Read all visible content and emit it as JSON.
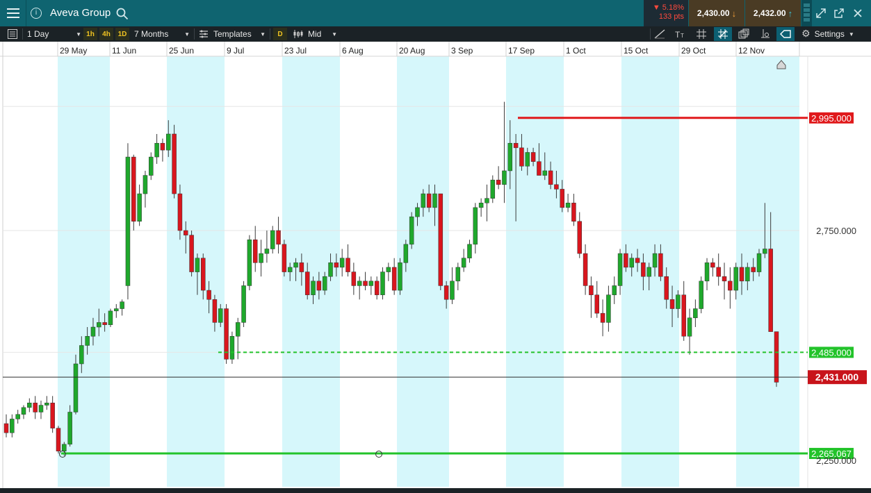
{
  "header": {
    "title": "Aveva Group",
    "change_pct": "▼ 5.18%",
    "change_pts": "133 pts",
    "sell_price": "2,430.00",
    "buy_price": "2,432.00"
  },
  "toolbar": {
    "interval": "1 Day",
    "quick_intervals": [
      "1h",
      "4h",
      "1D"
    ],
    "range": "7 Months",
    "templates_label": "Templates",
    "d_label": "D",
    "price_type": "Mid",
    "settings_label": "Settings"
  },
  "chart_data": {
    "type": "candlestick",
    "x_axis_ticks": [
      "29 May",
      "11 Jun",
      "25 Jun",
      "9 Jul",
      "23 Jul",
      "6 Aug",
      "20 Aug",
      "3 Sep",
      "17 Sep",
      "1 Oct",
      "15 Oct",
      "29 Oct",
      "12 Nov"
    ],
    "y_axis_ticks": [
      "2,250.000",
      "2,750.000"
    ],
    "y_range": [
      2210,
      3340
    ],
    "horizontal_lines": [
      {
        "label": "2,995.000",
        "value": 2995,
        "color": "#e0191b",
        "style": "solid"
      },
      {
        "label": "2,485.000",
        "value": 2485,
        "color": "#22c32a",
        "style": "dashed"
      },
      {
        "label": "2,265.067",
        "value": 2265.067,
        "color": "#22c32a",
        "style": "solid"
      }
    ],
    "current_price": {
      "label": "2,431.000",
      "value": 2431,
      "color": "#c8141b"
    },
    "colors": {
      "up": "#1fa82c",
      "down": "#d9161e",
      "band": "#d6f7fb",
      "grid": "#e6e6e6"
    },
    "candles": [
      [
        2330,
        2350,
        2300,
        2310
      ],
      [
        2310,
        2350,
        2300,
        2340
      ],
      [
        2340,
        2360,
        2330,
        2350
      ],
      [
        2350,
        2370,
        2340,
        2365
      ],
      [
        2365,
        2385,
        2355,
        2375
      ],
      [
        2375,
        2390,
        2340,
        2355
      ],
      [
        2355,
        2380,
        2340,
        2370
      ],
      [
        2370,
        2390,
        2360,
        2375
      ],
      [
        2375,
        2390,
        2310,
        2320
      ],
      [
        2320,
        2325,
        2265,
        2270
      ],
      [
        2270,
        2290,
        2260,
        2285
      ],
      [
        2285,
        2370,
        2280,
        2355
      ],
      [
        2355,
        2480,
        2350,
        2460
      ],
      [
        2460,
        2520,
        2440,
        2500
      ],
      [
        2500,
        2540,
        2480,
        2520
      ],
      [
        2520,
        2560,
        2500,
        2540
      ],
      [
        2540,
        2580,
        2520,
        2550
      ],
      [
        2550,
        2570,
        2530,
        2545
      ],
      [
        2545,
        2580,
        2540,
        2575
      ],
      [
        2575,
        2590,
        2560,
        2580
      ],
      [
        2580,
        2600,
        2565,
        2595
      ],
      [
        2630,
        2940,
        2600,
        2910
      ],
      [
        2910,
        2915,
        2750,
        2770
      ],
      [
        2770,
        2850,
        2760,
        2830
      ],
      [
        2830,
        2880,
        2800,
        2870
      ],
      [
        2870,
        2920,
        2860,
        2910
      ],
      [
        2910,
        2960,
        2895,
        2940
      ],
      [
        2940,
        2950,
        2900,
        2925
      ],
      [
        2925,
        2990,
        2910,
        2960
      ],
      [
        2960,
        2980,
        2820,
        2830
      ],
      [
        2830,
        2850,
        2730,
        2750
      ],
      [
        2750,
        2770,
        2700,
        2740
      ],
      [
        2740,
        2750,
        2650,
        2660
      ],
      [
        2660,
        2700,
        2610,
        2690
      ],
      [
        2690,
        2700,
        2600,
        2620
      ],
      [
        2620,
        2640,
        2570,
        2600
      ],
      [
        2600,
        2610,
        2530,
        2550
      ],
      [
        2550,
        2590,
        2540,
        2580
      ],
      [
        2580,
        2590,
        2460,
        2470
      ],
      [
        2470,
        2530,
        2460,
        2520
      ],
      [
        2520,
        2560,
        2470,
        2550
      ],
      [
        2550,
        2640,
        2540,
        2630
      ],
      [
        2630,
        2740,
        2620,
        2730
      ],
      [
        2730,
        2760,
        2660,
        2680
      ],
      [
        2680,
        2730,
        2650,
        2700
      ],
      [
        2700,
        2750,
        2680,
        2710
      ],
      [
        2710,
        2760,
        2700,
        2750
      ],
      [
        2750,
        2780,
        2700,
        2720
      ],
      [
        2720,
        2730,
        2650,
        2660
      ],
      [
        2660,
        2680,
        2640,
        2670
      ],
      [
        2670,
        2690,
        2640,
        2680
      ],
      [
        2680,
        2700,
        2630,
        2660
      ],
      [
        2660,
        2680,
        2600,
        2610
      ],
      [
        2610,
        2650,
        2590,
        2640
      ],
      [
        2640,
        2660,
        2600,
        2620
      ],
      [
        2620,
        2660,
        2610,
        2650
      ],
      [
        2650,
        2700,
        2640,
        2680
      ],
      [
        2680,
        2700,
        2650,
        2670
      ],
      [
        2670,
        2710,
        2650,
        2690
      ],
      [
        2690,
        2720,
        2650,
        2660
      ],
      [
        2660,
        2680,
        2610,
        2630
      ],
      [
        2630,
        2650,
        2600,
        2640
      ],
      [
        2640,
        2660,
        2620,
        2630
      ],
      [
        2630,
        2650,
        2610,
        2640
      ],
      [
        2640,
        2650,
        2600,
        2610
      ],
      [
        2610,
        2670,
        2600,
        2660
      ],
      [
        2660,
        2680,
        2640,
        2670
      ],
      [
        2670,
        2690,
        2610,
        2620
      ],
      [
        2620,
        2690,
        2610,
        2680
      ],
      [
        2680,
        2730,
        2660,
        2720
      ],
      [
        2720,
        2790,
        2710,
        2780
      ],
      [
        2780,
        2810,
        2760,
        2800
      ],
      [
        2800,
        2840,
        2780,
        2830
      ],
      [
        2830,
        2850,
        2790,
        2800
      ],
      [
        2800,
        2850,
        2760,
        2830
      ],
      [
        2830,
        2830,
        2620,
        2630
      ],
      [
        2630,
        2640,
        2580,
        2600
      ],
      [
        2600,
        2670,
        2590,
        2640
      ],
      [
        2640,
        2680,
        2620,
        2670
      ],
      [
        2670,
        2710,
        2660,
        2690
      ],
      [
        2690,
        2730,
        2680,
        2720
      ],
      [
        2720,
        2810,
        2700,
        2800
      ],
      [
        2800,
        2820,
        2780,
        2810
      ],
      [
        2810,
        2850,
        2770,
        2820
      ],
      [
        2820,
        2870,
        2810,
        2860
      ],
      [
        2860,
        2890,
        2840,
        2850
      ],
      [
        2850,
        3030,
        2810,
        2880
      ],
      [
        2880,
        2990,
        2840,
        2940
      ],
      [
        2940,
        2960,
        2770,
        2930
      ],
      [
        2930,
        2960,
        2880,
        2890
      ],
      [
        2890,
        2930,
        2870,
        2920
      ],
      [
        2920,
        2930,
        2890,
        2900
      ],
      [
        2900,
        2940,
        2870,
        2870
      ],
      [
        2870,
        2920,
        2860,
        2880
      ],
      [
        2880,
        2900,
        2840,
        2850
      ],
      [
        2850,
        2880,
        2820,
        2840
      ],
      [
        2840,
        2860,
        2790,
        2800
      ],
      [
        2800,
        2830,
        2790,
        2810
      ],
      [
        2810,
        2830,
        2760,
        2770
      ],
      [
        2770,
        2790,
        2690,
        2700
      ],
      [
        2700,
        2720,
        2610,
        2630
      ],
      [
        2630,
        2650,
        2560,
        2610
      ],
      [
        2610,
        2640,
        2560,
        2570
      ],
      [
        2570,
        2600,
        2520,
        2550
      ],
      [
        2550,
        2630,
        2530,
        2610
      ],
      [
        2610,
        2650,
        2590,
        2630
      ],
      [
        2630,
        2710,
        2610,
        2700
      ],
      [
        2700,
        2720,
        2660,
        2670
      ],
      [
        2670,
        2700,
        2650,
        2690
      ],
      [
        2690,
        2710,
        2660,
        2680
      ],
      [
        2680,
        2700,
        2620,
        2650
      ],
      [
        2650,
        2680,
        2620,
        2670
      ],
      [
        2670,
        2720,
        2650,
        2700
      ],
      [
        2700,
        2720,
        2640,
        2650
      ],
      [
        2650,
        2670,
        2580,
        2600
      ],
      [
        2600,
        2630,
        2540,
        2580
      ],
      [
        2580,
        2620,
        2560,
        2610
      ],
      [
        2610,
        2640,
        2510,
        2520
      ],
      [
        2520,
        2580,
        2480,
        2560
      ],
      [
        2560,
        2600,
        2540,
        2580
      ],
      [
        2580,
        2650,
        2570,
        2640
      ],
      [
        2640,
        2690,
        2620,
        2680
      ],
      [
        2680,
        2690,
        2650,
        2670
      ],
      [
        2670,
        2700,
        2630,
        2650
      ],
      [
        2650,
        2680,
        2600,
        2640
      ],
      [
        2640,
        2670,
        2580,
        2620
      ],
      [
        2620,
        2680,
        2600,
        2670
      ],
      [
        2670,
        2700,
        2610,
        2640
      ],
      [
        2640,
        2680,
        2620,
        2670
      ],
      [
        2670,
        2690,
        2640,
        2660
      ],
      [
        2660,
        2710,
        2650,
        2700
      ],
      [
        2700,
        2810,
        2690,
        2710
      ],
      [
        2710,
        2790,
        2530,
        2530
      ],
      [
        2530,
        2530,
        2410,
        2420
      ]
    ]
  }
}
